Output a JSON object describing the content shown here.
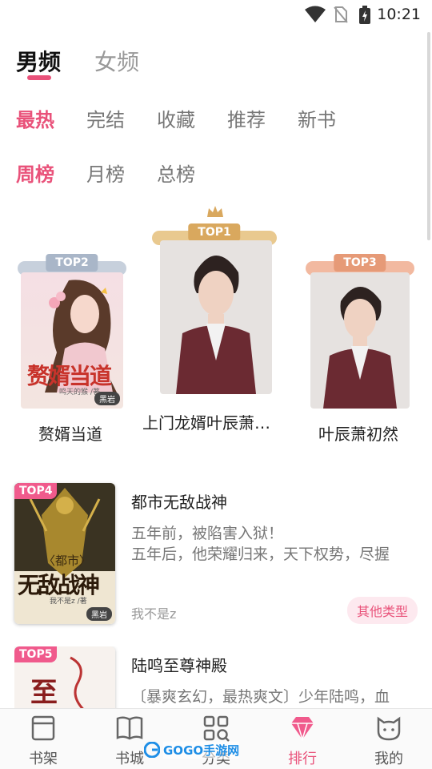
{
  "status_bar": {
    "time": "10:21"
  },
  "gender_tabs": [
    {
      "label": "男频",
      "active": true
    },
    {
      "label": "女频",
      "active": false
    }
  ],
  "category_tabs": [
    {
      "label": "最热",
      "active": true
    },
    {
      "label": "完结",
      "active": false
    },
    {
      "label": "收藏",
      "active": false
    },
    {
      "label": "推荐",
      "active": false
    },
    {
      "label": "新书",
      "active": false
    }
  ],
  "period_tabs": [
    {
      "label": "周榜",
      "active": true
    },
    {
      "label": "月榜",
      "active": false
    },
    {
      "label": "总榜",
      "active": false
    }
  ],
  "podium": {
    "top1": {
      "rank": "TOP1",
      "title": "上门龙婿叶辰萧…"
    },
    "top2": {
      "rank": "TOP2",
      "title": "赘婿当道",
      "cover_text": "赘婿当道",
      "cover_author": "鸣天的猴 /著",
      "cover_publisher": "黑岩"
    },
    "top3": {
      "rank": "TOP3",
      "title": "叶辰萧初然"
    }
  },
  "list": [
    {
      "rank": "TOP4",
      "title": "都市无敌战神",
      "desc_line1": "五年前，被陷害入狱！",
      "desc_line2": "五年后，他荣耀归来，天下权势，尽握",
      "author": "我不是z",
      "tag": "其他类型",
      "cover_prefix": "〈都市〉",
      "cover_text": "无敌战神",
      "cover_author": "我不是z /著",
      "cover_publisher": "黑岩"
    },
    {
      "rank": "TOP5",
      "title": "陆鸣至尊神殿",
      "desc_line1": "〔暴爽玄幻，最热爽文〕少年陆鸣，血",
      "cover_text": "至"
    }
  ],
  "bottom_nav": [
    {
      "label": "书架",
      "icon": "bookshelf-icon",
      "active": false
    },
    {
      "label": "书城",
      "icon": "open-book-icon",
      "active": false
    },
    {
      "label": "分类",
      "icon": "category-grid-icon",
      "active": false
    },
    {
      "label": "排行",
      "icon": "diamond-icon",
      "active": true
    },
    {
      "label": "我的",
      "icon": "cat-face-icon",
      "active": false
    }
  ],
  "watermark": "GOGO手游网",
  "colors": {
    "accent": "#e9527a",
    "gold": "#d9a85e",
    "silver": "#a9b6c8",
    "bronze": "#e69a77"
  }
}
